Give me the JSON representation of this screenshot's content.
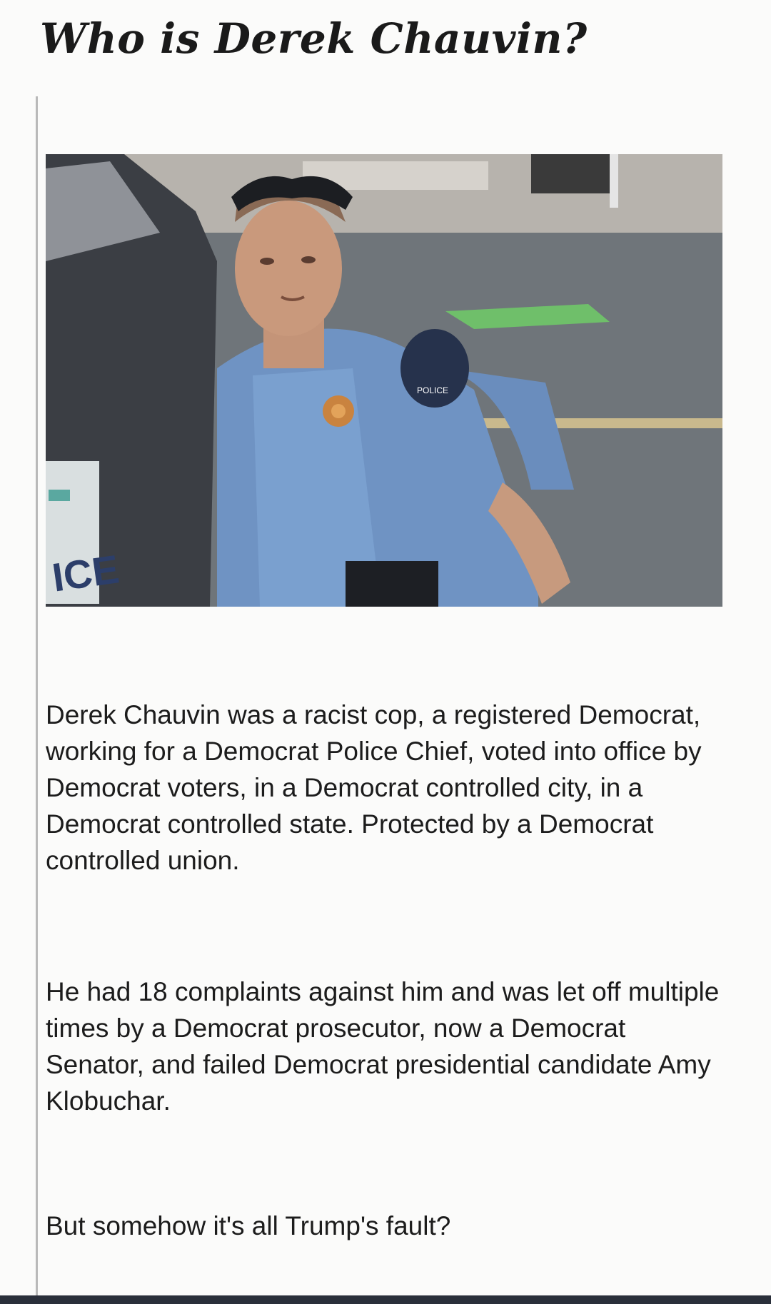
{
  "article": {
    "title": "Who is Derek Chauvin?",
    "paragraphs": [
      "Derek Chauvin was a racist cop, a registered Democrat, working for a Democrat Police Chief, voted into office by Democrat voters, in a Democrat controlled city, in a Democrat controlled state. Protected by a Democrat controlled union.",
      "He had 18 complaints against him and was let off multiple times by a Democrat prosecutor, now a Democrat Senator, and failed Democrat presidential candidate Amy Klobuchar.",
      "But somehow it's all Trump's fault?"
    ]
  },
  "photo": {
    "plate_text": "ICE",
    "patch_text": "POLICE"
  }
}
